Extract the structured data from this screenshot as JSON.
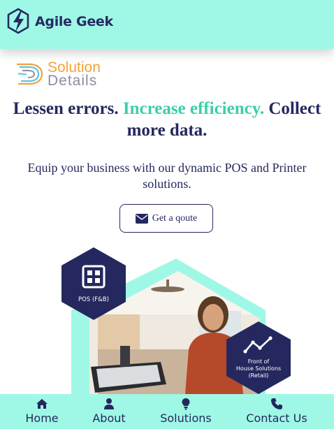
{
  "header": {
    "brand_name": "Agile Geek",
    "brand_icon": "lightning-hexagon-icon"
  },
  "partner": {
    "line1": "Solution",
    "line2": "Details"
  },
  "hero": {
    "headline_part1": "Lessen errors.",
    "headline_accent": "Increase efficiency.",
    "headline_part2": "Collect more data.",
    "subtitle": "Equip your business with our dynamic POS and Printer solutions.",
    "cta_label": "Get a qoute",
    "badge_pos": "POS (F&B)",
    "badge_retail_line1": "Front of",
    "badge_retail_line2": "House Solutions",
    "badge_retail_line3": "(Retail)"
  },
  "bottom_nav": {
    "items": [
      {
        "label": "Home",
        "icon": "home-icon"
      },
      {
        "label": "About",
        "icon": "user-icon"
      },
      {
        "label": "Solutions",
        "icon": "lightbulb-icon"
      },
      {
        "label": "Contact Us",
        "icon": "phone-icon"
      }
    ]
  },
  "colors": {
    "bar": "#9ff8e6",
    "navy": "#25285e",
    "accent": "#3ccfa9",
    "partner_orange": "#f2a23a"
  }
}
